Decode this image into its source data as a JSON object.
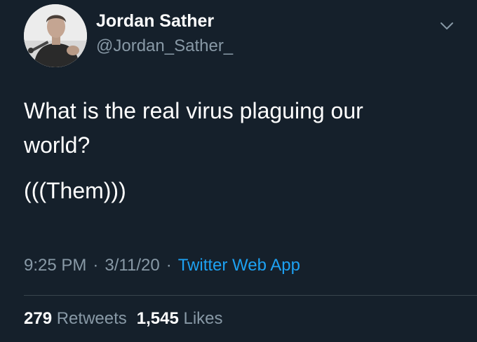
{
  "author": {
    "display_name": "Jordan Sather",
    "handle": "@Jordan_Sather_",
    "avatar": "profile-photo"
  },
  "tweet": {
    "line1": "What is the real virus plaguing our",
    "line2": "world?",
    "line3": "(((Them)))"
  },
  "meta": {
    "time": "9:25 PM",
    "separator": "·",
    "date": "3/11/20",
    "source": "Twitter Web App"
  },
  "stats": {
    "retweets_count": "279",
    "retweets_label": "Retweets",
    "likes_count": "1,545",
    "likes_label": "Likes"
  },
  "icons": {
    "menu": "chevron-down-icon"
  },
  "colors": {
    "background": "#15202b",
    "text": "#ffffff",
    "secondary_text": "#8899a6",
    "link": "#1da1f2",
    "divider": "#38444d"
  }
}
